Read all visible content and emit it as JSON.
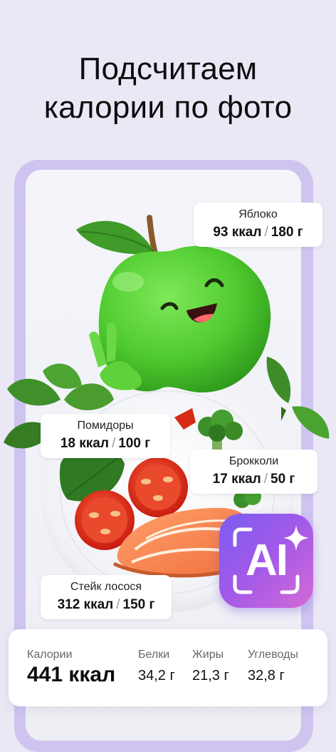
{
  "headline": {
    "line1": "Подсчитаем",
    "line2": "калории по фото"
  },
  "food_tags": [
    {
      "name": "Яблоко",
      "kcal": "93 ккал",
      "grams": "180 г"
    },
    {
      "name": "Помидоры",
      "kcal": "18 ккал",
      "grams": "100 г"
    },
    {
      "name": "Брокколи",
      "kcal": "17 ккал",
      "grams": "50 г"
    },
    {
      "name": "Стейк лосося",
      "kcal": "312 ккал",
      "grams": "150 г"
    }
  ],
  "separator": "/",
  "ai_badge": {
    "label": "AI",
    "icon": "sparkle-icon"
  },
  "summary": {
    "calories_label": "Калории",
    "calories_value": "441 ккал",
    "protein_label": "Белки",
    "protein_value": "34,2 г",
    "fat_label": "Жиры",
    "fat_value": "21,3 г",
    "carbs_label": "Углеводы",
    "carbs_value": "32,8 г"
  },
  "colors": {
    "background": "#ebe8f6",
    "frame": "#cfc4f0",
    "apple": "#5fd13a",
    "ai_gradient_start": "#7a5cf2",
    "ai_gradient_end": "#d56ad6"
  }
}
